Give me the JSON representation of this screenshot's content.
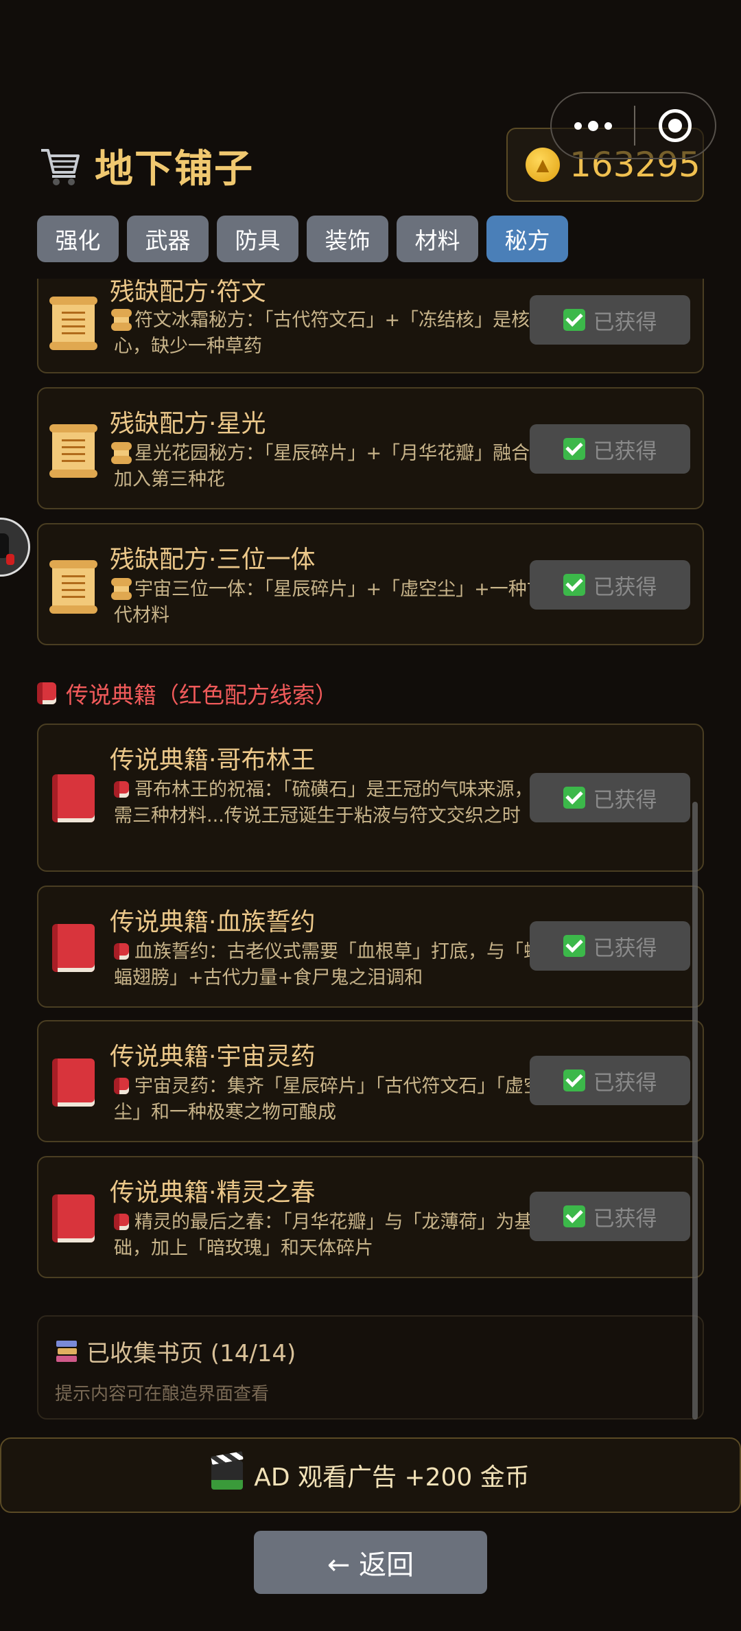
{
  "shop": {
    "title": "地下铺子",
    "coins": "163295"
  },
  "tabs": [
    {
      "label": "强化",
      "active": false
    },
    {
      "label": "武器",
      "active": false
    },
    {
      "label": "防具",
      "active": false
    },
    {
      "label": "装饰",
      "active": false
    },
    {
      "label": "材料",
      "active": false
    },
    {
      "label": "秘方",
      "active": true
    }
  ],
  "recipe_cards": [
    {
      "name": "残缺配方·符文",
      "desc": "符文冰霜秘方：「古代符文石」+「冻结核」是核心，缺少一种草药",
      "status": "已获得",
      "icon": "scroll-icon"
    },
    {
      "name": "残缺配方·星光",
      "desc": "星光花园秘方：「星辰碎片」+「月华花瓣」融合后加入第三种花",
      "status": "已获得",
      "icon": "scroll-icon"
    },
    {
      "name": "残缺配方·三位一体",
      "desc": "宇宙三位一体：「星辰碎片」+「虚空尘」+一种古代材料",
      "status": "已获得",
      "icon": "scroll-icon"
    }
  ],
  "legend_section": {
    "title": "传说典籍（红色配方线索）"
  },
  "legend_cards": [
    {
      "name": "传说典籍·哥布林王",
      "desc": "哥布林王的祝福：「硫磺石」是王冠的气味来源，还需三种材料...传说王冠诞生于粘液与符文交织之时",
      "status": "已获得",
      "icon": "book-icon"
    },
    {
      "name": "传说典籍·血族誓约",
      "desc": "血族誓约：古老仪式需要「血根草」打底，与「蝙蝠翅膀」+古代力量+食尸鬼之泪调和",
      "status": "已获得",
      "icon": "book-icon"
    },
    {
      "name": "传说典籍·宇宙灵药",
      "desc": "宇宙灵药：集齐「星辰碎片」「古代符文石」「虚空尘」和一种极寒之物可酿成",
      "status": "已获得",
      "icon": "book-icon"
    },
    {
      "name": "传说典籍·精灵之春",
      "desc": "精灵的最后之春：「月华花瓣」与「龙薄荷」为基础，加上「暗玫瑰」和天体碎片",
      "status": "已获得",
      "icon": "book-icon"
    }
  ],
  "collection": {
    "title": "已收集书页 (14/14)",
    "hint": "提示内容可在酿造界面查看"
  },
  "ad_button": {
    "label": "AD 观看广告 +200 金币"
  },
  "back_button": {
    "label": "← 返回"
  },
  "colors": {
    "accent_gold": "#f0c870",
    "active_tab": "#4a7fb8",
    "tab": "#6b717c",
    "legend_red": "#f05a5a",
    "owned_check": "#3cb84a"
  }
}
